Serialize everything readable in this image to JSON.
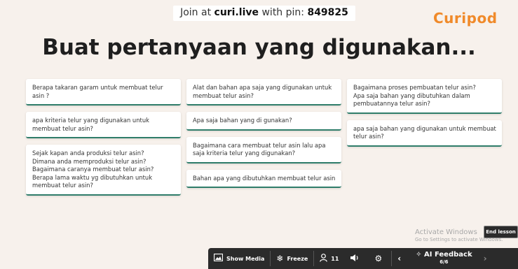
{
  "join": {
    "prefix": "Join at ",
    "site": "curi.live",
    "middle": " with pin: ",
    "pin": "849825"
  },
  "logo": "Curipod",
  "title": "Buat pertanyaan yang digunakan...",
  "accent_color": "#2f7d6a",
  "columns": [
    [
      "Berapa takaran garam untuk membuat telur asin ?",
      "apa kriteria telur yang digunakan untuk membuat telur asin?",
      "Sejak kapan anda produksi telur asin?\nDimana anda memproduksi telur asin?\nBagaimana caranya membuat telur asin?\nBerapa lama waktu yg dibutuhkan untuk membuat telur asin?"
    ],
    [
      "Alat dan bahan apa saja yang digunakan untuk membuat telur asin?",
      "Apa saja bahan yang di gunakan?",
      "Bagaimana cara membuat telur asin lalu apa saja kriteria telur yang digunakan?",
      "Bahan apa yang dibutuhkan membuat telur asin"
    ],
    [
      "Bagaimana proses pembuatan telur asin?\nApa saja bahan yang dibutuhkan dalam pembuatannya telur asin?",
      "apa saja bahan yang digunakan untuk membuat telur asin?"
    ]
  ],
  "toolbar": {
    "show_media": "Show Media",
    "freeze": "Freeze",
    "participants": "11",
    "ai_feedback": "AI Feedback",
    "ai_count": "6/6"
  },
  "activate": {
    "title": "Activate Windows",
    "sub": "Go to Settings to activate Windows."
  },
  "end_lesson": "End lesson"
}
